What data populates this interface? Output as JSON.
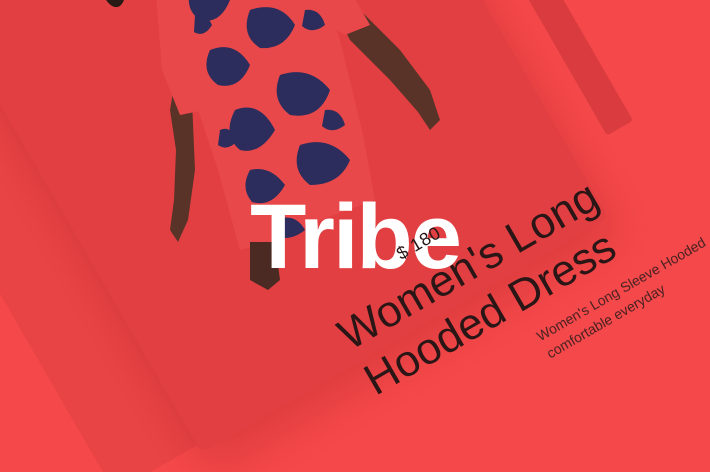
{
  "brand": {
    "logo_text": "Tribe"
  },
  "product": {
    "price": "$ 180",
    "title_line1": "Women's Long",
    "title_line2": "Hooded Dress",
    "description_line1": "Women's Long Sleeve Hooded",
    "description_line2": "comfortable everyday"
  },
  "colors": {
    "background": "#f4484a",
    "card": "#e23f42",
    "logo": "#ffffff",
    "dress_primary": "#e8484a",
    "dress_pattern": "#2c2d5c",
    "skin": "#5a3328"
  }
}
